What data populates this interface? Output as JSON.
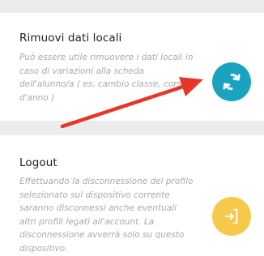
{
  "section_local_data": {
    "title": "Rimuovi dati locali",
    "description": "Può essere utile rimuovere i dati locali in caso di variazioni alla scheda dell'alunno/a ( es. cambio classe, corso d'anno )",
    "button_icon": "sync-icon",
    "button_color": "#1aa3bf"
  },
  "section_logout": {
    "title": "Logout",
    "description": "Effettuando la disconnessione del profilo selezionato sul dispositivo corrente saranno disconnessi anche eventuali altri profili legati all'account. La disconnessione avverrà solo su questo dispositivo.",
    "button_icon": "logout-icon",
    "button_color": "#f6c94b"
  },
  "annotation": {
    "arrow_color": "#e8352a"
  }
}
